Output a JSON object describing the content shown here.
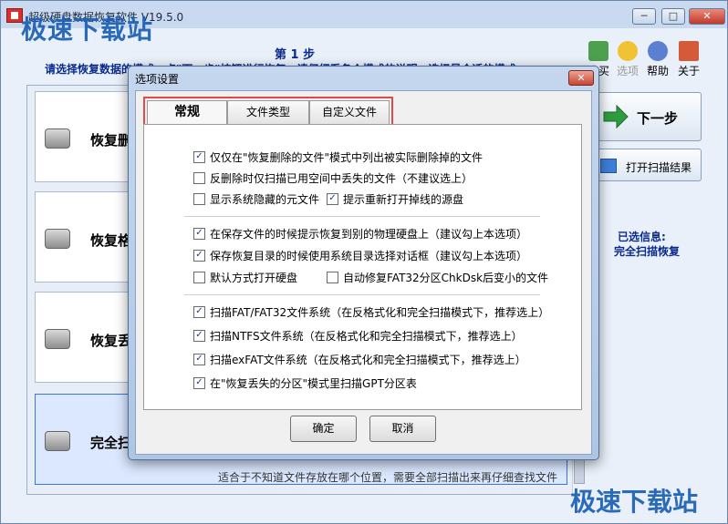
{
  "window": {
    "title": "超级硬盘数据恢复软件 V19.5.0",
    "watermark": "极速下载站",
    "controls": [
      "─",
      "□",
      "✕"
    ]
  },
  "header": {
    "step_title": "第 1 步",
    "step_desc": "请选择恢复数据的模式，点\"下一步\"按钮进行恢复。请仔细看各个模式的说明，选择最合适的模式"
  },
  "toolbar": {
    "items": [
      {
        "icon": "cart-icon",
        "label": "购买"
      },
      {
        "icon": "gear-icon",
        "label": "选项"
      },
      {
        "icon": "help-icon",
        "label": "帮助"
      },
      {
        "icon": "home-icon",
        "label": "关于"
      }
    ]
  },
  "cards": [
    {
      "title": "恢复删除的文件",
      "desc": ""
    },
    {
      "title": "恢复格式化的分区",
      "desc": ""
    },
    {
      "title": "恢复丢失的分区",
      "desc": ""
    },
    {
      "title": "完全扫描恢复",
      "desc": "适合于不知道文件存放在哪个位置，需要全部扫描出来再仔细查找文件"
    }
  ],
  "side": {
    "next_label": "下一步",
    "open_label": "打开扫描结果",
    "selected_label": "已选信息:",
    "selected_value": "完全扫描恢复"
  },
  "dialog": {
    "title": "选项设置",
    "close": "✕",
    "tabs": [
      "常规",
      "文件类型",
      "自定义文件"
    ],
    "options": [
      {
        "label": "仅仅在\"恢复删除的文件\"模式中列出被实际删除掉的文件",
        "checked": true
      },
      {
        "label": "反删除时仅扫描已用空间中丢失的文件（不建议选上）",
        "checked": false
      },
      {
        "label": "显示系统隐藏的元文件",
        "checked": false
      },
      {
        "label": "提示重新打开掉线的源盘",
        "checked": true
      },
      {
        "label": "在保存文件的时候提示恢复到别的物理硬盘上（建议勾上本选项）",
        "checked": true
      },
      {
        "label": "保存恢复目录的时候使用系统目录选择对话框（建议勾上本选项）",
        "checked": true
      },
      {
        "label": "默认方式打开硬盘",
        "checked": false
      },
      {
        "label": "自动修复FAT32分区ChkDsk后变小的文件",
        "checked": false
      },
      {
        "label": "扫描FAT/FAT32文件系统（在反格式化和完全扫描模式下，推荐选上）",
        "checked": true
      },
      {
        "label": "扫描NTFS文件系统（在反格式化和完全扫描模式下，推荐选上）",
        "checked": true
      },
      {
        "label": "扫描exFAT文件系统（在反格式化和完全扫描模式下，推荐选上）",
        "checked": true
      },
      {
        "label": "在\"恢复丢失的分区\"模式里扫描GPT分区表",
        "checked": true
      }
    ],
    "ok": "确定",
    "cancel": "取消"
  },
  "colors": {
    "accent": "#0a2a8c",
    "highlight_border": "#e04a4a",
    "watermark": "#1a5fb4"
  }
}
